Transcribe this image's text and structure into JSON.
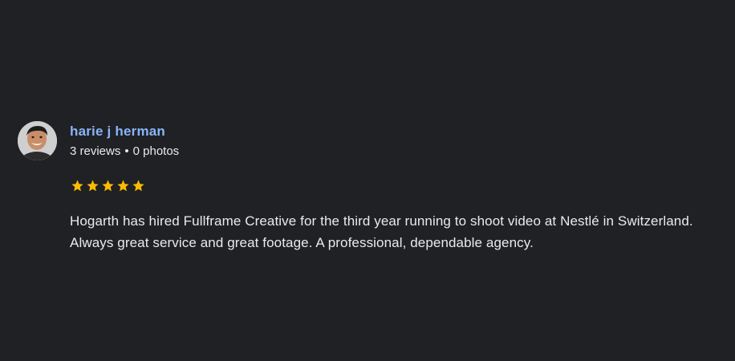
{
  "review": {
    "author": {
      "name": "harie j herman",
      "reviews_count": "3 reviews",
      "separator": "•",
      "photos_count": "0 photos",
      "avatar_icon": "user-photo-avatar"
    },
    "rating": {
      "value": 5,
      "max": 5,
      "star_color": "#fbbc04",
      "icon": "star-icon"
    },
    "text": "Hogarth has hired Fullframe Creative for the third year running to shoot video at Nestlé in Switzerland. Always great service and great footage. A professional, dependable agency."
  },
  "colors": {
    "background": "#202124",
    "author_name": "#8ab4f8",
    "text": "#e8eaed"
  }
}
